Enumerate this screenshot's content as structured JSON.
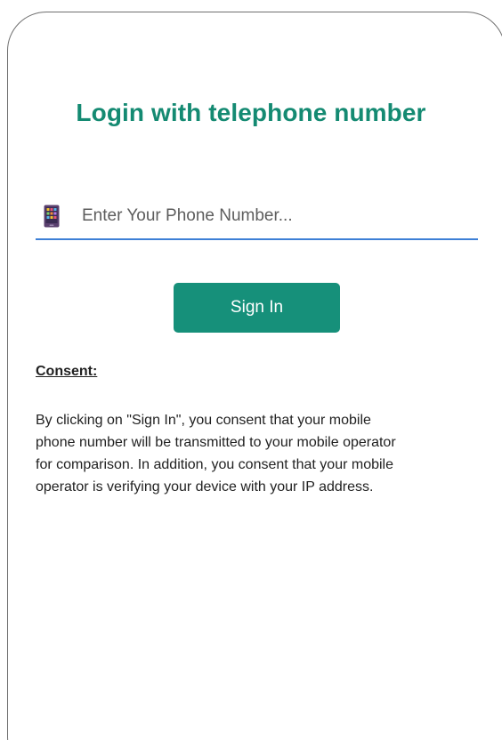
{
  "login": {
    "title": "Login with telephone number",
    "phone_placeholder": "Enter Your Phone Number...",
    "phone_value": "",
    "phone_icon": "mobile-phone-icon",
    "signin_label": "Sign In"
  },
  "consent": {
    "heading": "Consent:",
    "lines": [
      "By clicking on \"Sign In\", you consent that your mobile",
      "phone number will be transmitted to your mobile operator",
      "for comparison. In addition, you consent that your mobile",
      "operator is verifying your device with your IP address."
    ]
  },
  "colors": {
    "accent": "#16907a",
    "title": "#148a72",
    "input_underline": "#3d7fd6"
  }
}
